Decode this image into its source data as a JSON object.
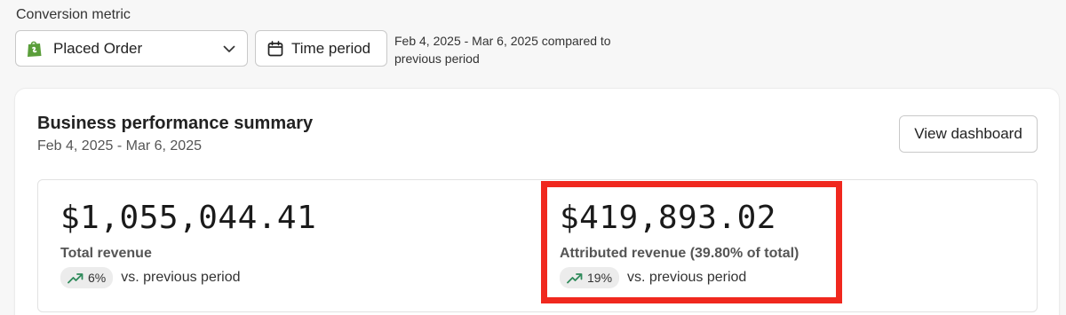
{
  "filters": {
    "conversion_metric_label": "Conversion metric",
    "selected_metric": "Placed Order",
    "time_period_label": "Time period",
    "period_description": "Feb 4, 2025 - Mar 6, 2025 compared to previous period"
  },
  "summary": {
    "title": "Business performance summary",
    "date_range": "Feb 4, 2025 - Mar 6, 2025",
    "view_dashboard_label": "View dashboard",
    "total_revenue": {
      "value": "$1,055,044.41",
      "label": "Total revenue",
      "change": "6%",
      "comparison": "vs. previous period"
    },
    "attributed_revenue": {
      "value": "$419,893.02",
      "label": "Attributed revenue (39.80% of total)",
      "change": "19%",
      "comparison": "vs. previous period"
    }
  },
  "colors": {
    "highlight": "#f0281e",
    "trend_up": "#2e8a5a",
    "shopify_green": "#5a9e3a"
  },
  "icons": {
    "metric_source": "shopify-bag-icon",
    "dropdown": "chevron-down-icon",
    "time_period": "calendar-icon",
    "trend": "trend-up-icon"
  }
}
